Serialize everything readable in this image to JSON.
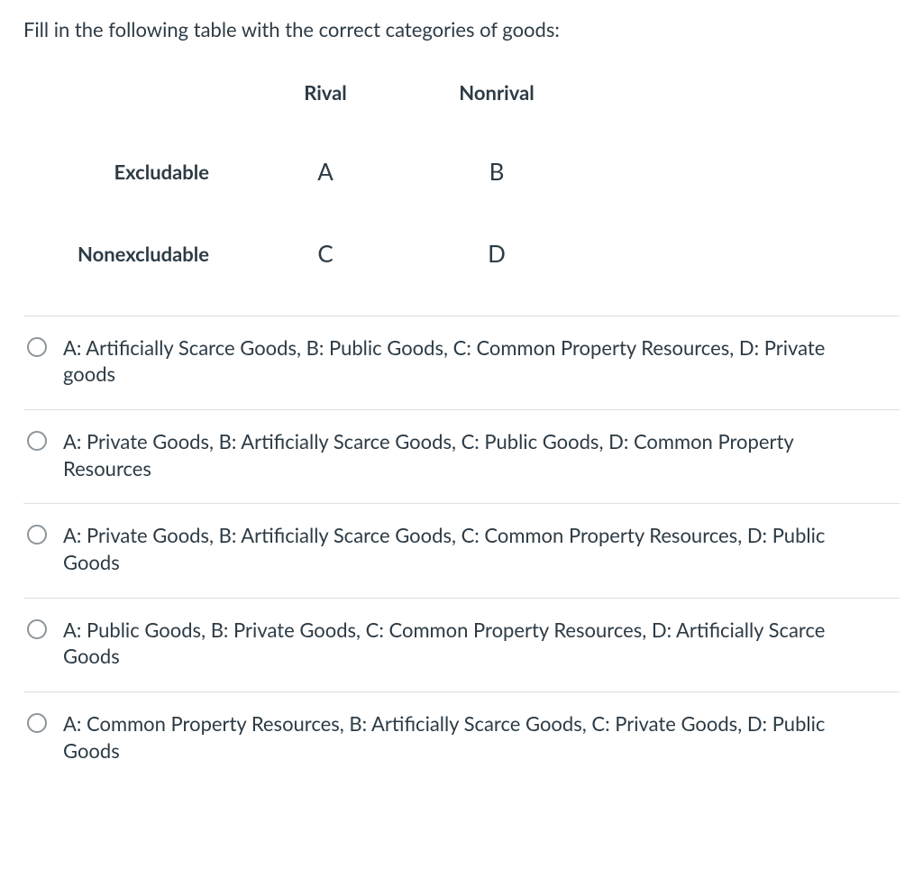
{
  "prompt": "Fill in the following table with the correct categories of goods:",
  "table": {
    "col1": "Rival",
    "col2": "Nonrival",
    "row1": "Excludable",
    "row2": "Nonexcludable",
    "cellA": "A",
    "cellB": "B",
    "cellC": "C",
    "cellD": "D"
  },
  "options": [
    "A: Artificially Scarce Goods, B: Public Goods, C: Common Property Resources, D: Private goods",
    "A: Private Goods, B: Artificially Scarce Goods, C: Public Goods, D: Common Property Resources",
    "A: Private Goods, B: Artificially Scarce Goods, C: Common Property Resources, D: Public Goods",
    "A: Public Goods, B: Private Goods, C: Common Property Resources, D: Artificially Scarce Goods",
    "A: Common Property Resources, B: Artificially Scarce Goods, C: Private Goods, D: Public Goods"
  ]
}
